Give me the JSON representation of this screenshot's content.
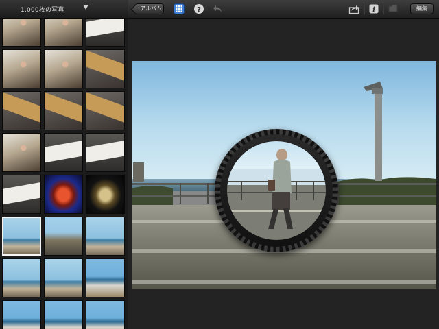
{
  "toolbar": {
    "photo_count": "1,000枚の写真",
    "album_label": "アルバム",
    "edit_label": "編集",
    "icons": [
      "caret-down-icon",
      "grid-icon",
      "help-icon",
      "undo-icon",
      "share-icon",
      "info-icon",
      "flag-icon"
    ],
    "accent": "#4a8fe6"
  },
  "sidebar": {
    "thumbnails": [
      {
        "name": "thumb-1",
        "style": "t-indoor"
      },
      {
        "name": "thumb-2",
        "style": "t-indoor"
      },
      {
        "name": "thumb-3",
        "style": "t-book"
      },
      {
        "name": "thumb-4",
        "style": "t-indoor"
      },
      {
        "name": "thumb-5",
        "style": "t-indoor"
      },
      {
        "name": "thumb-6",
        "style": "t-box"
      },
      {
        "name": "thumb-7",
        "style": "t-box"
      },
      {
        "name": "thumb-8",
        "style": "t-box"
      },
      {
        "name": "thumb-9",
        "style": "t-box"
      },
      {
        "name": "thumb-10",
        "style": "t-indoor"
      },
      {
        "name": "thumb-11",
        "style": "t-book"
      },
      {
        "name": "thumb-12",
        "style": "t-book"
      },
      {
        "name": "thumb-13",
        "style": "t-book"
      },
      {
        "name": "thumb-14",
        "style": "t-red"
      },
      {
        "name": "thumb-15",
        "style": "t-glass"
      },
      {
        "name": "thumb-16",
        "style": "t-beach",
        "selected": true
      },
      {
        "name": "thumb-17",
        "style": "t-bike"
      },
      {
        "name": "thumb-18",
        "style": "t-beach"
      },
      {
        "name": "thumb-19",
        "style": "t-beach"
      },
      {
        "name": "thumb-20",
        "style": "t-beach"
      },
      {
        "name": "thumb-21",
        "style": "t-sea2"
      },
      {
        "name": "thumb-22",
        "style": "t-sea2"
      },
      {
        "name": "thumb-23",
        "style": "t-sea2"
      },
      {
        "name": "thumb-24",
        "style": "t-sea2"
      }
    ]
  },
  "viewer": {
    "photo_description_icon": "loupe-icon"
  }
}
